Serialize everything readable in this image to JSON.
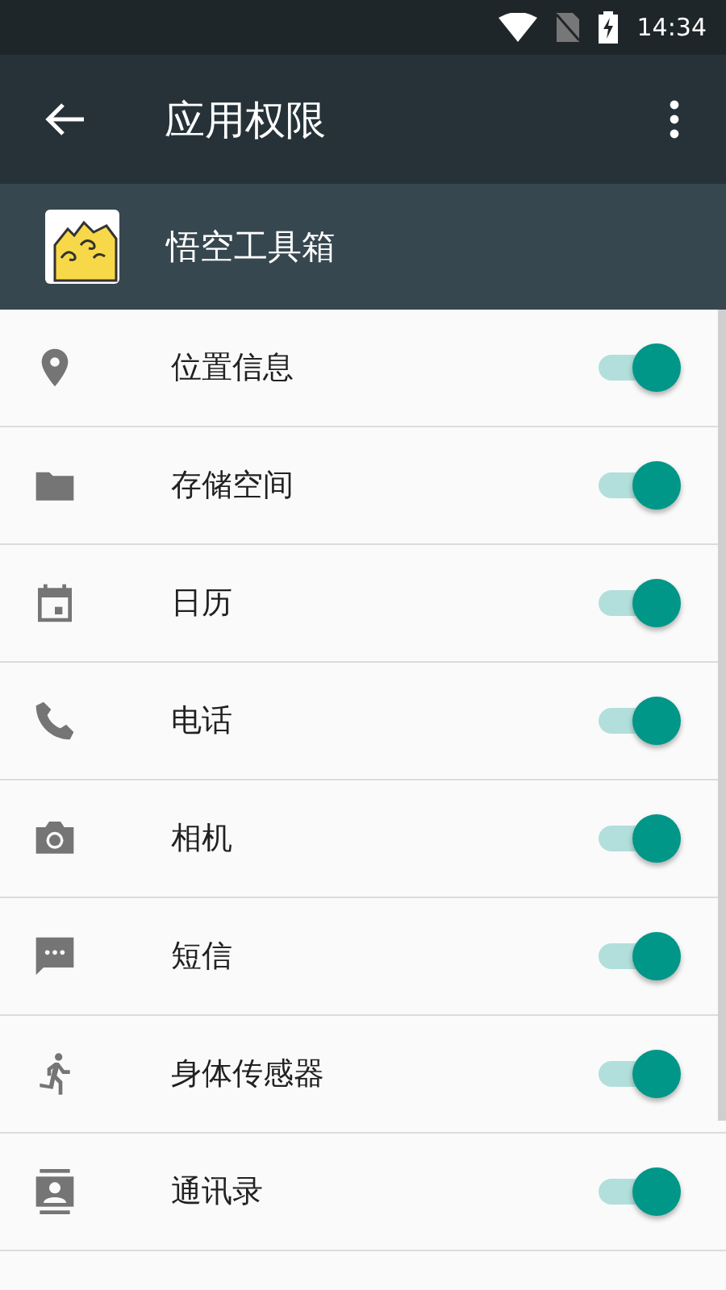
{
  "status_bar": {
    "time": "14:34"
  },
  "app_bar": {
    "title": "应用权限"
  },
  "app": {
    "name": "悟空工具箱"
  },
  "permissions": [
    {
      "label": "位置信息",
      "checked": true
    },
    {
      "label": "存储空间",
      "checked": true
    },
    {
      "label": "日历",
      "checked": true
    },
    {
      "label": "电话",
      "checked": true
    },
    {
      "label": "相机",
      "checked": true
    },
    {
      "label": "短信",
      "checked": true
    },
    {
      "label": "身体传感器",
      "checked": true
    },
    {
      "label": "通讯录",
      "checked": true
    }
  ]
}
